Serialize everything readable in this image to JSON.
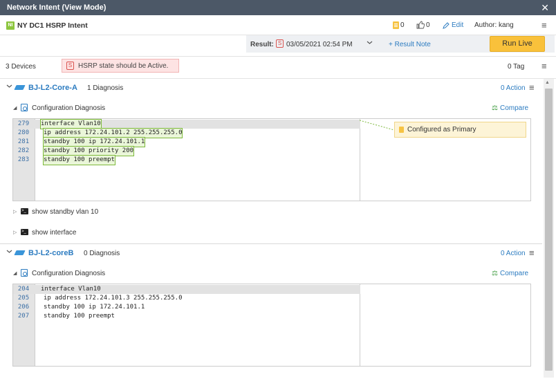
{
  "window": {
    "title": "Network Intent (View Mode)",
    "close_glyph": "✕"
  },
  "header": {
    "badge": "NI",
    "intent_name": "NY DC1 HSRP Intent",
    "note_count": "0",
    "like_count": "0",
    "edit_label": "Edit",
    "author": "Author: kang"
  },
  "result": {
    "label": "Result:",
    "status": "S",
    "date": "03/05/2021 02:54 PM",
    "add_note": "+ Result Note",
    "run_live": "Run Live"
  },
  "summary": {
    "device_count": "3 Devices",
    "message_status": "S",
    "message": "HSRP state should be Active.",
    "tag_count": "0 Tag"
  },
  "devices": [
    {
      "name": "BJ-L2-Core-A",
      "diagnosis": "1 Diagnosis",
      "action": "0 Action",
      "config_label": "Configuration Diagnosis",
      "compare_label": "Compare",
      "lines": [
        {
          "num": "279",
          "text": "interface Vlan10"
        },
        {
          "num": "280",
          "text": "ip address 172.24.101.2 255.255.255.0"
        },
        {
          "num": "281",
          "text": "standby 100 ip 172.24.101.1"
        },
        {
          "num": "282",
          "text": "standby 100 priority 200"
        },
        {
          "num": "283",
          "text": "standby 100 preempt"
        }
      ],
      "annotation": "Configured as Primary",
      "cli": [
        "show standby vlan 10",
        "show interface"
      ]
    },
    {
      "name": "BJ-L2-coreB",
      "diagnosis": "0 Diagnosis",
      "action": "0 Action",
      "config_label": "Configuration Diagnosis",
      "compare_label": "Compare",
      "lines": [
        {
          "num": "204",
          "text": "interface Vlan10"
        },
        {
          "num": "205",
          "text": "ip address 172.24.101.3 255.255.255.0"
        },
        {
          "num": "206",
          "text": "standby 100 ip 172.24.101.1"
        },
        {
          "num": "207",
          "text": "standby 100 preempt"
        }
      ]
    }
  ],
  "colors": {
    "titlebar": "#4c5867",
    "accent": "#2b7bc0",
    "run_live": "#f9c13b",
    "highlight": "#7cb83a",
    "error": "#d9534f"
  }
}
